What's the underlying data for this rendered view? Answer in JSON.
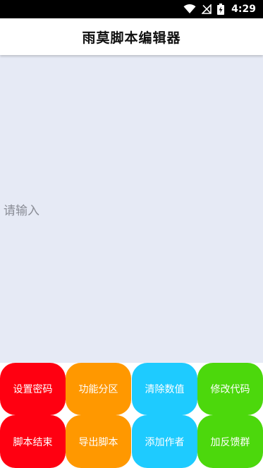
{
  "status_bar": {
    "time": "4:29",
    "icons": [
      "wifi-icon",
      "no-signal-icon",
      "battery-charging-icon"
    ]
  },
  "header": {
    "title": "雨莫脚本编辑器"
  },
  "editor": {
    "placeholder": "请输入",
    "value": ""
  },
  "buttons": [
    {
      "label": "设置密码",
      "color": "#ff0011"
    },
    {
      "label": "功能分区",
      "color": "#ff9800"
    },
    {
      "label": "清除数值",
      "color": "#1ecbff"
    },
    {
      "label": "修改代码",
      "color": "#4cd80c"
    },
    {
      "label": "脚本结束",
      "color": "#ff0011"
    },
    {
      "label": "导出脚本",
      "color": "#ff9800"
    },
    {
      "label": "添加作者",
      "color": "#1ecbff"
    },
    {
      "label": "加反馈群",
      "color": "#4cd80c"
    }
  ]
}
